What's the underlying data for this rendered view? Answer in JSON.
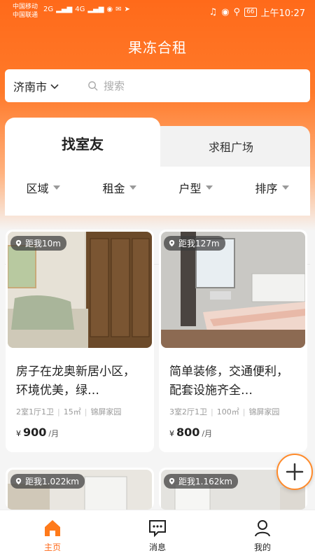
{
  "status_bar": {
    "carrier_1": "中国移动",
    "carrier_2": "中国联通",
    "signal_1": "2G",
    "signal_2": "4G",
    "battery": "66",
    "time": "上午10:27"
  },
  "app_title": "果冻合租",
  "search": {
    "city": "济南市",
    "placeholder": "搜索"
  },
  "tabs": {
    "active": "找室友",
    "inactive": "求租广场"
  },
  "filters": [
    "区域",
    "租金",
    "户型",
    "排序"
  ],
  "listings": [
    {
      "distance": "距我10m",
      "title": "房子在龙奥新居小区，环境优美，绿…",
      "layout": "2室1厅1卫",
      "area": "15㎡",
      "community": "锦屏家园",
      "currency": "¥",
      "price": "900",
      "unit": "/月"
    },
    {
      "distance": "距我127m",
      "title": "简单装修，交通便利，配套设施齐全…",
      "layout": "3室2厅1卫",
      "area": "100㎡",
      "community": "锦屏家园",
      "currency": "¥",
      "price": "800",
      "unit": "/月"
    },
    {
      "distance": "距我1.022km"
    },
    {
      "distance": "距我1.162km"
    }
  ],
  "nav": {
    "home": "主页",
    "messages": "消息",
    "mine": "我的"
  },
  "colors": {
    "accent": "#ff6a1a",
    "fab_border": "#ff8a2a"
  }
}
